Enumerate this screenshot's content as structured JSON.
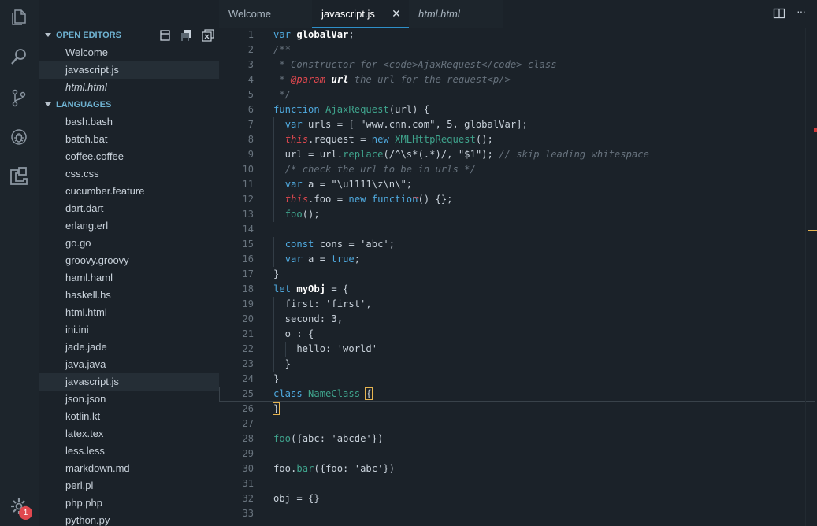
{
  "sidebar": {
    "open_editors_label": "OPEN EDITORS",
    "open_editors": [
      {
        "label": "Welcome"
      },
      {
        "label": "javascript.js"
      },
      {
        "label": "html.html"
      }
    ],
    "languages_label": "LANGUAGES",
    "languages": [
      "bash.bash",
      "batch.bat",
      "coffee.coffee",
      "css.css",
      "cucumber.feature",
      "dart.dart",
      "erlang.erl",
      "go.go",
      "groovy.groovy",
      "haml.haml",
      "haskell.hs",
      "html.html",
      "ini.ini",
      "jade.jade",
      "java.java",
      "javascript.js",
      "json.json",
      "kotlin.kt",
      "latex.tex",
      "less.less",
      "markdown.md",
      "perl.pl",
      "php.php",
      "python.py"
    ]
  },
  "activity_bar": {
    "icons": [
      "files-icon",
      "search-icon",
      "source-control-icon",
      "debug-icon",
      "extensions-icon",
      "gear-icon"
    ],
    "settings_badge": "1"
  },
  "tabs": [
    {
      "label": "Welcome",
      "active": false
    },
    {
      "label": "javascript.js",
      "active": true,
      "close_glyph": "✕"
    },
    {
      "label": "html.html",
      "active": false
    }
  ],
  "editor_actions": {
    "more_glyph": "···"
  },
  "colors": {
    "keyword": "#4fa9de",
    "function": "#3fa38c",
    "comment": "#67727d",
    "this": "#e0484f",
    "accent": "#2e8fc8",
    "badge": "#e0484f"
  },
  "code_lines": [
    {
      "n": "1",
      "t": "var globalVar;"
    },
    {
      "n": "2",
      "t": "/**"
    },
    {
      "n": "3",
      "t": " * Constructor for <code>AjaxRequest</code> class"
    },
    {
      "n": "4",
      "t": " * @param url the url for the request<p/>"
    },
    {
      "n": "5",
      "t": " */"
    },
    {
      "n": "6",
      "t": "function AjaxRequest(url) {"
    },
    {
      "n": "7",
      "t": "  var urls = [ \"www.cnn.com\", 5, globalVar];"
    },
    {
      "n": "8",
      "t": "  this.request = new XMLHttpRequest();"
    },
    {
      "n": "9",
      "t": "  url = url.replace(/^\\s*(.*)/, \"$1\"); // skip leading whitespace"
    },
    {
      "n": "10",
      "t": "  /* check the url to be in urls */"
    },
    {
      "n": "11",
      "t": "  var a = \"\\u1111\\z\\n\\\";"
    },
    {
      "n": "12",
      "t": "  this.foo = new function() {};"
    },
    {
      "n": "13",
      "t": "  foo();"
    },
    {
      "n": "14",
      "t": ""
    },
    {
      "n": "15",
      "t": "  const cons = 'abc';"
    },
    {
      "n": "16",
      "t": "  var a = true;"
    },
    {
      "n": "17",
      "t": "}"
    },
    {
      "n": "18",
      "t": "let myObj = {"
    },
    {
      "n": "19",
      "t": "  first: 'first',"
    },
    {
      "n": "20",
      "t": "  second: 3,"
    },
    {
      "n": "21",
      "t": "  o : {"
    },
    {
      "n": "22",
      "t": "    hello: 'world'"
    },
    {
      "n": "23",
      "t": "  }"
    },
    {
      "n": "24",
      "t": "}"
    },
    {
      "n": "25",
      "t": "class NameClass {"
    },
    {
      "n": "26",
      "t": "}"
    },
    {
      "n": "27",
      "t": ""
    },
    {
      "n": "28",
      "t": "foo({abc: 'abcde'})"
    },
    {
      "n": "29",
      "t": ""
    },
    {
      "n": "30",
      "t": "foo.bar({foo: 'abc'})"
    },
    {
      "n": "31",
      "t": ""
    },
    {
      "n": "32",
      "t": "obj = {}"
    },
    {
      "n": "33",
      "t": ""
    }
  ]
}
